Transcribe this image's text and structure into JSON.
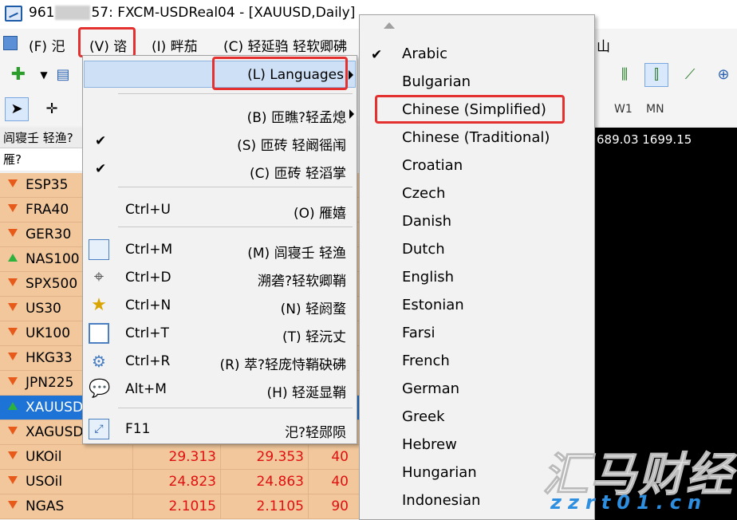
{
  "window": {
    "title_prefix": "961",
    "title_suffix": "57: FXCM-USDReal04 - [XAUUSD,Daily]"
  },
  "menubar": {
    "items": [
      "(F) 汜",
      "(V) 谘",
      "(I) 畔茄",
      "(C) 轻延驺 轻软卿砩",
      "山"
    ]
  },
  "toolbar": {
    "timeframes": [
      "W1",
      "MN"
    ]
  },
  "market_watch": {
    "header": "闾寝壬 轻渔?",
    "column_label": "雁?",
    "rows": [
      {
        "symbol": "ESP35",
        "dir": "down",
        "bid": "",
        "ask": "",
        "spread": ""
      },
      {
        "symbol": "FRA40",
        "dir": "down",
        "bid": "",
        "ask": "",
        "spread": ""
      },
      {
        "symbol": "GER30",
        "dir": "down",
        "bid": "",
        "ask": "",
        "spread": ""
      },
      {
        "symbol": "NAS100",
        "dir": "up",
        "bid": "",
        "ask": "",
        "spread": ""
      },
      {
        "symbol": "SPX500",
        "dir": "down",
        "bid": "",
        "ask": "",
        "spread": ""
      },
      {
        "symbol": "US30",
        "dir": "down",
        "bid": "",
        "ask": "",
        "spread": ""
      },
      {
        "symbol": "UK100",
        "dir": "down",
        "bid": "",
        "ask": "",
        "spread": ""
      },
      {
        "symbol": "HKG33",
        "dir": "down",
        "bid": "",
        "ask": "",
        "spread": ""
      },
      {
        "symbol": "JPN225",
        "dir": "down",
        "bid": "",
        "ask": "",
        "spread": ""
      },
      {
        "symbol": "XAUUSD",
        "dir": "up",
        "bid": "",
        "ask": "",
        "spread": "",
        "selected": true
      },
      {
        "symbol": "XAGUSD",
        "dir": "down",
        "bid": "",
        "ask": "",
        "spread": ""
      },
      {
        "symbol": "UKOil",
        "dir": "down",
        "bid": "29.313",
        "ask": "29.353",
        "spread": "40"
      },
      {
        "symbol": "USOil",
        "dir": "down",
        "bid": "24.823",
        "ask": "24.863",
        "spread": "40"
      },
      {
        "symbol": "NGAS",
        "dir": "down",
        "bid": "2.1015",
        "ask": "2.1105",
        "spread": "90"
      }
    ]
  },
  "chart": {
    "prices": "689.03 1699.15"
  },
  "view_menu": {
    "items": [
      {
        "label": "(L) Languages",
        "shortcut": "",
        "submenu": true,
        "highlighted": true
      },
      {
        "label": "(B) 匝瞧?轻孟熄",
        "shortcut": "",
        "submenu": true
      },
      {
        "label": "(S) 匝砖 轻阚徭闱",
        "shortcut": "",
        "checked": true
      },
      {
        "label": "(C) 匝砖 轻滔掌",
        "shortcut": "",
        "checked": true
      },
      {
        "label": "(O) 雁嬉",
        "shortcut": "Ctrl+U"
      },
      {
        "label": "(M) 闾寝壬 轻渔",
        "shortcut": "Ctrl+M",
        "icon": "market-watch-icon"
      },
      {
        "label": "溯砻?轻软卿鞘",
        "shortcut": "Ctrl+D",
        "icon": "crosshair-icon"
      },
      {
        "label": "(N) 轻阏蝥",
        "shortcut": "Ctrl+N",
        "icon": "navigator-icon"
      },
      {
        "label": "(T) 轻沅丈",
        "shortcut": "Ctrl+T",
        "icon": "terminal-icon"
      },
      {
        "label": "(R) 萃?轻庞恃鞘砄砩",
        "shortcut": "Ctrl+R",
        "icon": "tester-icon"
      },
      {
        "label": "(H) 轻涎显鞘",
        "shortcut": "Alt+M",
        "icon": "chat-icon"
      },
      {
        "label": "汜?轻郧陨",
        "shortcut": "F11",
        "icon": "fullscreen-icon"
      }
    ]
  },
  "languages_menu": {
    "items": [
      "Arabic",
      "Bulgarian",
      "Chinese (Simplified)",
      "Chinese (Traditional)",
      "Croatian",
      "Czech",
      "Danish",
      "Dutch",
      "English",
      "Estonian",
      "Farsi",
      "French",
      "German",
      "Greek",
      "Hebrew",
      "Hungarian",
      "Indonesian"
    ],
    "checked": "Arabic"
  },
  "watermark": {
    "brand": "汇马财经",
    "site": "zzrt01.cn"
  },
  "colors": {
    "highlight_box": "#e53030",
    "selection": "#1e73d6",
    "row_bg": "#f1c79b",
    "price_red": "#e01010"
  }
}
